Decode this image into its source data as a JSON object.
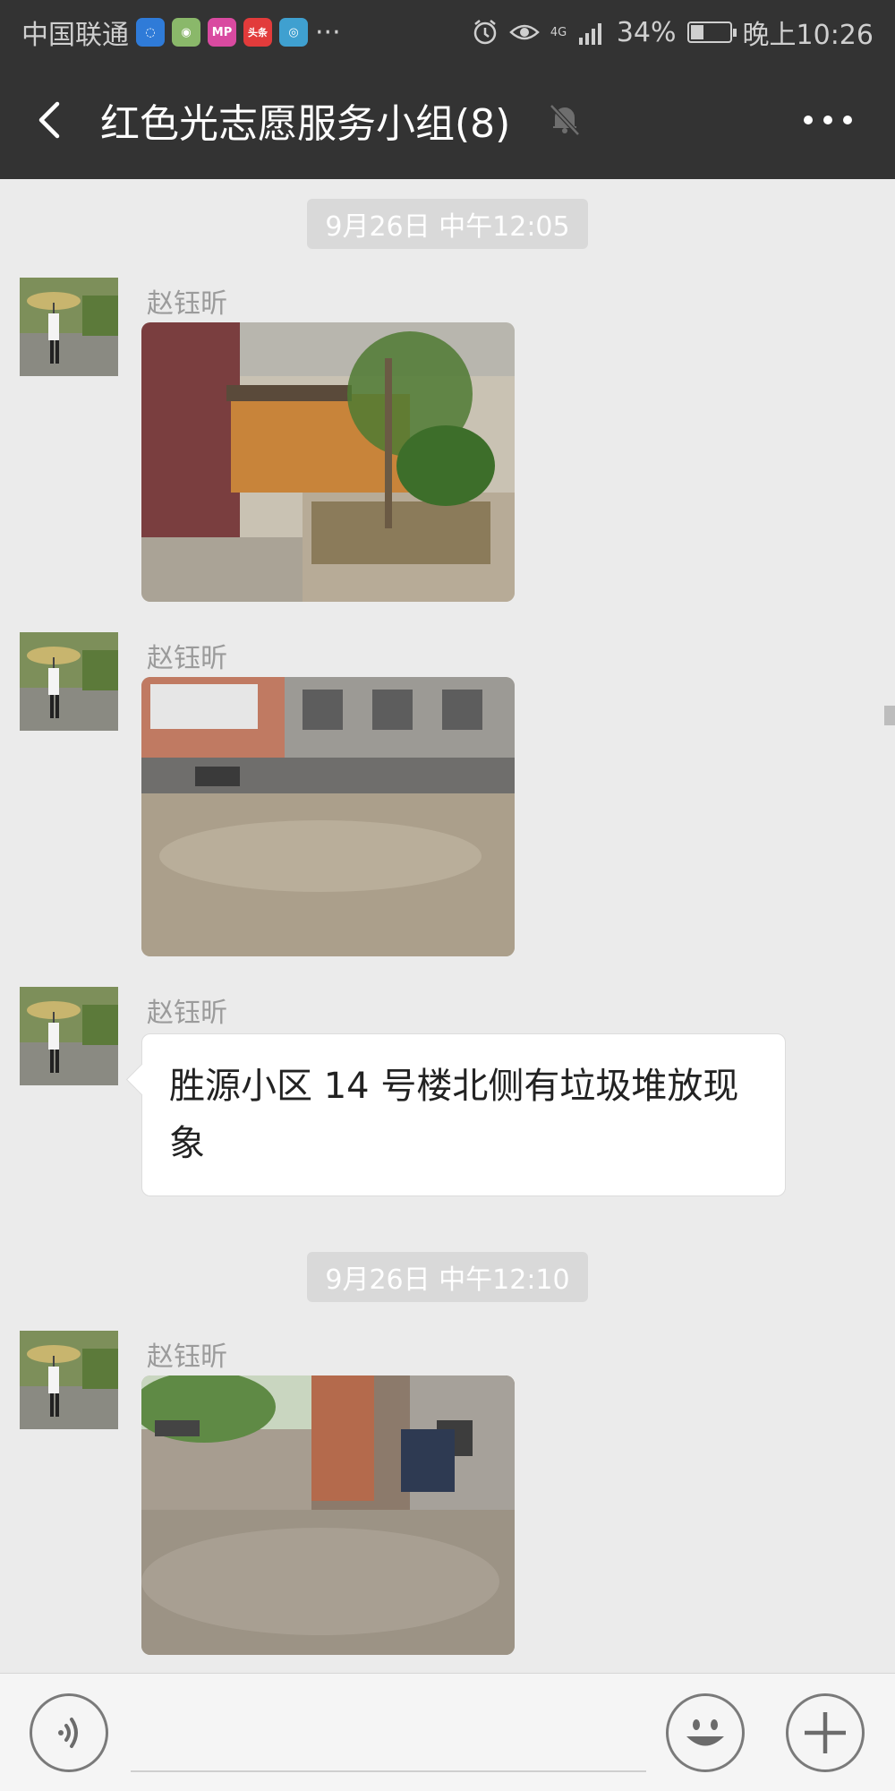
{
  "status_bar": {
    "carrier": "中国联通",
    "app_icons": [
      {
        "name": "wechat-notify-icon",
        "color": "#2f7bd8",
        "glyph": "◌"
      },
      {
        "name": "app-green-icon",
        "color": "#8ab86a",
        "glyph": "◉"
      },
      {
        "name": "mp-app-icon",
        "color": "#d94aa0",
        "glyph": "MP"
      },
      {
        "name": "toutiao-icon",
        "color": "#e23b3b",
        "glyph": "头条"
      },
      {
        "name": "browser-app-icon",
        "color": "#3fa0d0",
        "glyph": "◎"
      }
    ],
    "more_dots": "···",
    "network": "4G",
    "battery_percent_text": "34%",
    "battery_level": 0.34,
    "time": "晚上10:26"
  },
  "header": {
    "title": "红色光志愿服务小组(8)",
    "muted": true
  },
  "messages": [
    {
      "type": "timestamp",
      "text": "9月26日 中午12:05"
    },
    {
      "type": "image",
      "sender": "赵钰昕",
      "image": "photo-1"
    },
    {
      "type": "image",
      "sender": "赵钰昕",
      "image": "photo-2"
    },
    {
      "type": "text",
      "sender": "赵钰昕",
      "text": "胜源小区 14 号楼北侧有垃圾堆放现象"
    },
    {
      "type": "timestamp",
      "text": "9月26日 中午12:10"
    },
    {
      "type": "image",
      "sender": "赵钰昕",
      "image": "photo-3"
    }
  ],
  "input": {
    "value": "",
    "placeholder": ""
  },
  "colors": {
    "header_bg": "#333333",
    "chat_bg": "#ebebeb",
    "timestamp_bg": "#d9d9d9",
    "bubble_bg": "#ffffff"
  }
}
